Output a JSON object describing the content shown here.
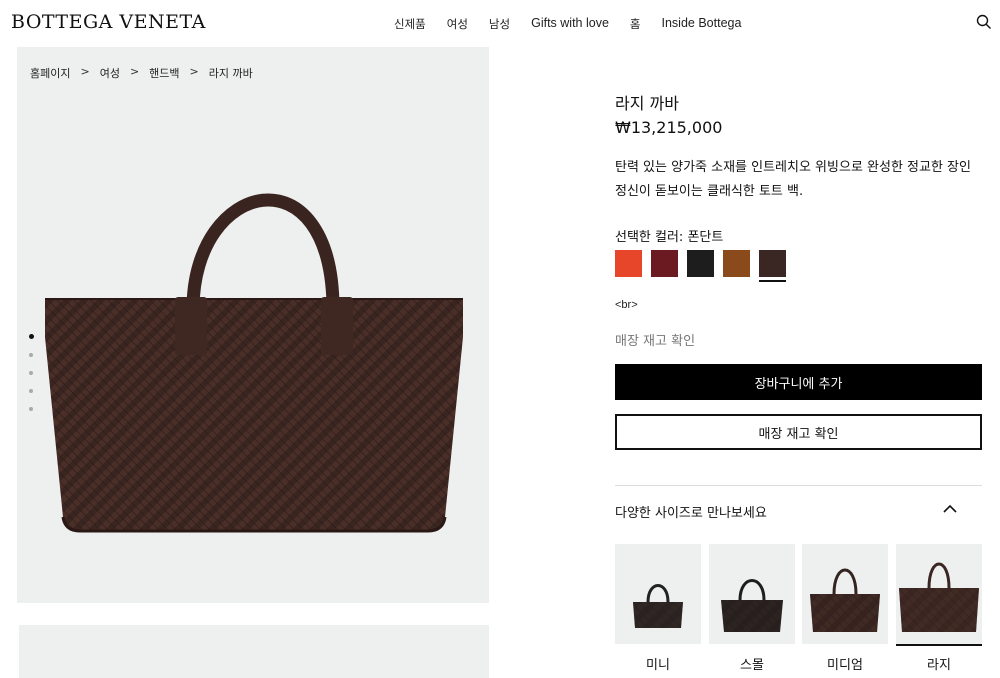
{
  "header": {
    "logo": "BOTTEGA VENETA",
    "nav": [
      "신제품",
      "여성",
      "남성",
      "Gifts with love",
      "홈",
      "Inside Bottega"
    ]
  },
  "breadcrumb": [
    "홈페이지",
    "여성",
    "핸드백",
    "라지 까바"
  ],
  "breadcrumb_sep": ">",
  "product": {
    "title": "라지 까바",
    "price": "₩13,215,000",
    "description": "탄력 있는 양가죽 소재를 인트레치오 위빙으로 완성한 정교한 장인 정신이 돋보이는 클래식한 토트 백.",
    "color_label": "선택한 컬러: 폰단트",
    "br_text": "<br>",
    "stock_link": "매장 재고 확인",
    "add_to_cart": "장바구니에 추가",
    "check_stock": "매장 재고 확인"
  },
  "swatches": [
    {
      "name": "orange",
      "color": "#e8462a"
    },
    {
      "name": "burgundy",
      "color": "#6b1a22"
    },
    {
      "name": "black",
      "color": "#1d1d1d"
    },
    {
      "name": "caramel",
      "color": "#8a4a1c"
    },
    {
      "name": "fondant",
      "color": "#3a2622",
      "selected": true
    }
  ],
  "sizes": {
    "title": "다양한 사이즈로 만나보세요",
    "items": [
      {
        "label": "미니",
        "color": "#222222"
      },
      {
        "label": "스몰",
        "color": "#1e1e1e"
      },
      {
        "label": "미디엄",
        "color": "#33241f"
      },
      {
        "label": "라지",
        "color": "#3a2622",
        "selected": true
      }
    ]
  },
  "gallery": {
    "dots": 5,
    "active": 0
  }
}
